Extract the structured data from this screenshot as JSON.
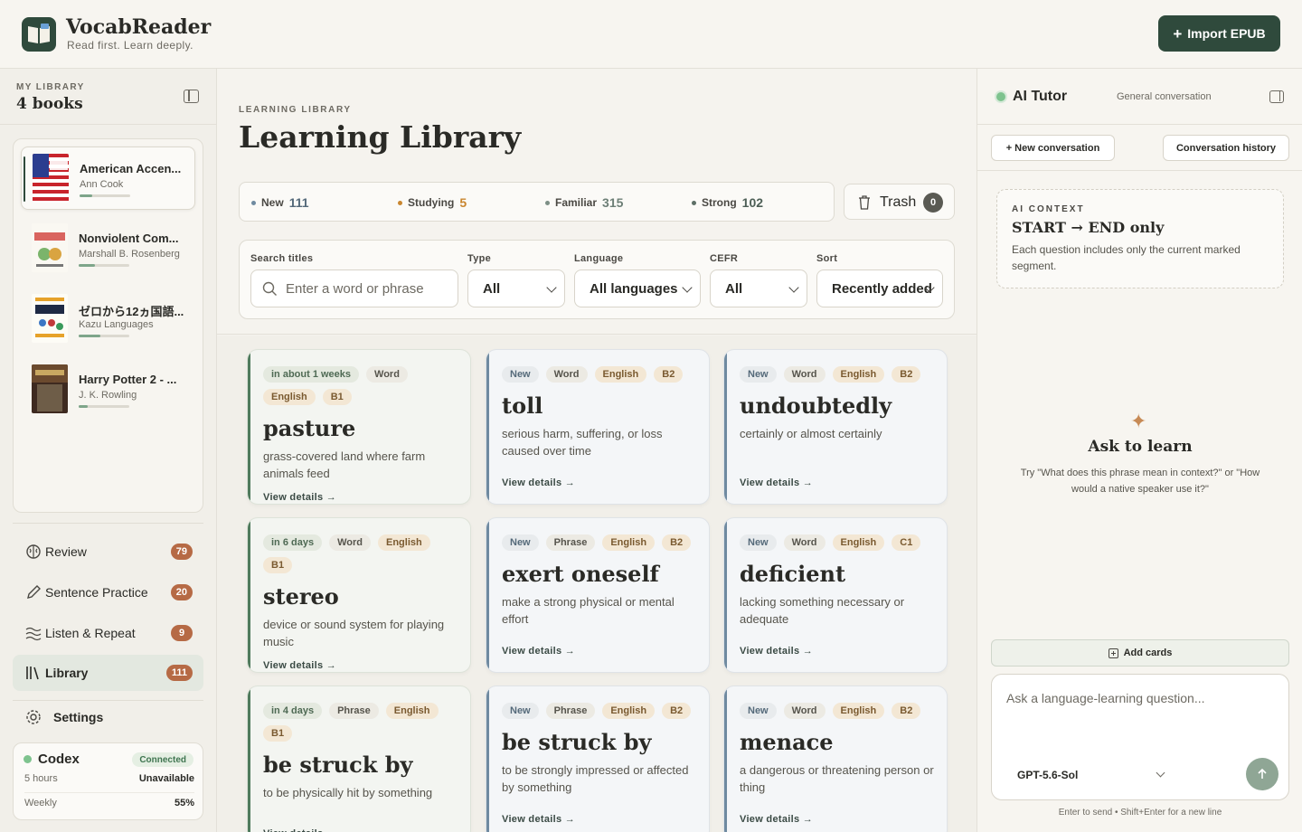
{
  "app": {
    "name": "VocabReader",
    "tagline": "Read first. Learn deeply.",
    "import_label": "Import EPUB"
  },
  "library": {
    "kicker": "MY LIBRARY",
    "count": "4 books",
    "books": [
      {
        "title": "American Accen...",
        "author": "Ann Cook",
        "progress": 0.25
      },
      {
        "title": "Nonviolent Com...",
        "author": "Marshall B. Rosenberg",
        "progress": 0.32
      },
      {
        "title": "ゼロから12ヵ国語...",
        "author": "Kazu Languages",
        "progress": 0.42
      },
      {
        "title": "Harry Potter 2 - ...",
        "author": "J. K. Rowling",
        "progress": 0.18
      }
    ]
  },
  "nav": [
    {
      "label": "Review",
      "badge": "79",
      "icon": "brain-icon"
    },
    {
      "label": "Sentence Practice",
      "badge": "20",
      "icon": "pencil-icon"
    },
    {
      "label": "Listen & Repeat",
      "badge": "9",
      "icon": "waves-icon"
    },
    {
      "label": "Library",
      "badge": "111",
      "icon": "books-icon",
      "active": true
    },
    {
      "label": "Settings",
      "icon": "gear-icon"
    }
  ],
  "codex": {
    "name": "Codex",
    "status": "Connected",
    "rows": [
      {
        "label": "5 hours",
        "value": "Unavailable"
      },
      {
        "label": "Weekly",
        "value": "55%"
      }
    ]
  },
  "main": {
    "kicker": "LEARNING LIBRARY",
    "title": "Learning Library",
    "stats": [
      {
        "label": "New",
        "value": "111",
        "color": "#6f8aa0"
      },
      {
        "label": "Studying",
        "value": "5",
        "color": "#c9862f"
      },
      {
        "label": "Familiar",
        "value": "315",
        "color": "#7d8f86"
      },
      {
        "label": "Strong",
        "value": "102",
        "color": "#5d6f66"
      }
    ],
    "trash": {
      "label": "Trash",
      "count": "0"
    },
    "filters": {
      "search_label": "Search titles",
      "search_placeholder": "Enter a word or phrase",
      "type_label": "Type",
      "type_value": "All",
      "language_label": "Language",
      "language_value": "All languages",
      "cefr_label": "CEFR",
      "cefr_value": "All",
      "sort_label": "Sort",
      "sort_value": "Recently added"
    },
    "view_details": "View details →",
    "cards": [
      {
        "tags": [
          "in about 1 weeks",
          "Word",
          "English",
          "B1"
        ],
        "term": "pasture",
        "definition": "grass-covered land where farm animals feed",
        "learning": true
      },
      {
        "tags": [
          "New",
          "Word",
          "English",
          "B2"
        ],
        "term": "toll",
        "definition": "serious harm, suffering, or loss caused over time"
      },
      {
        "tags": [
          "New",
          "Word",
          "English",
          "B2"
        ],
        "term": "undoubtedly",
        "definition": "certainly or almost certainly"
      },
      {
        "tags": [
          "in 6 days",
          "Word",
          "English",
          "B1"
        ],
        "term": "stereo",
        "definition": "device or sound system for playing music",
        "learning": true
      },
      {
        "tags": [
          "New",
          "Phrase",
          "English",
          "B2"
        ],
        "term": "exert oneself",
        "definition": "make a strong physical or mental effort"
      },
      {
        "tags": [
          "New",
          "Word",
          "English",
          "C1"
        ],
        "term": "deficient",
        "definition": "lacking something necessary or adequate"
      },
      {
        "tags": [
          "in 4 days",
          "Phrase",
          "English",
          "B1"
        ],
        "term": "be struck by",
        "definition": "to be physically hit by something",
        "learning": true
      },
      {
        "tags": [
          "New",
          "Phrase",
          "English",
          "B2"
        ],
        "term": "be struck by",
        "definition": "to be strongly impressed or affected by something"
      },
      {
        "tags": [
          "New",
          "Word",
          "English",
          "B2"
        ],
        "term": "menace",
        "definition": "a dangerous or threatening person or thing"
      }
    ]
  },
  "tutor": {
    "title": "AI Tutor",
    "subtitle": "General conversation",
    "new_conversation": "+ New conversation",
    "history": "Conversation history",
    "context_kicker": "AI CONTEXT",
    "context_title": "START → END only",
    "context_desc": "Each question includes only the current marked segment.",
    "ask_title": "Ask to learn",
    "ask_hint": "Try \"What does this phrase mean in context?\" or \"How would a native speaker use it?\"",
    "add_cards": "Add cards",
    "input_placeholder": "Ask a language-learning question...",
    "model": "GPT-5.6-Sol",
    "footer_hint": "Enter to send • Shift+Enter for a new line"
  }
}
